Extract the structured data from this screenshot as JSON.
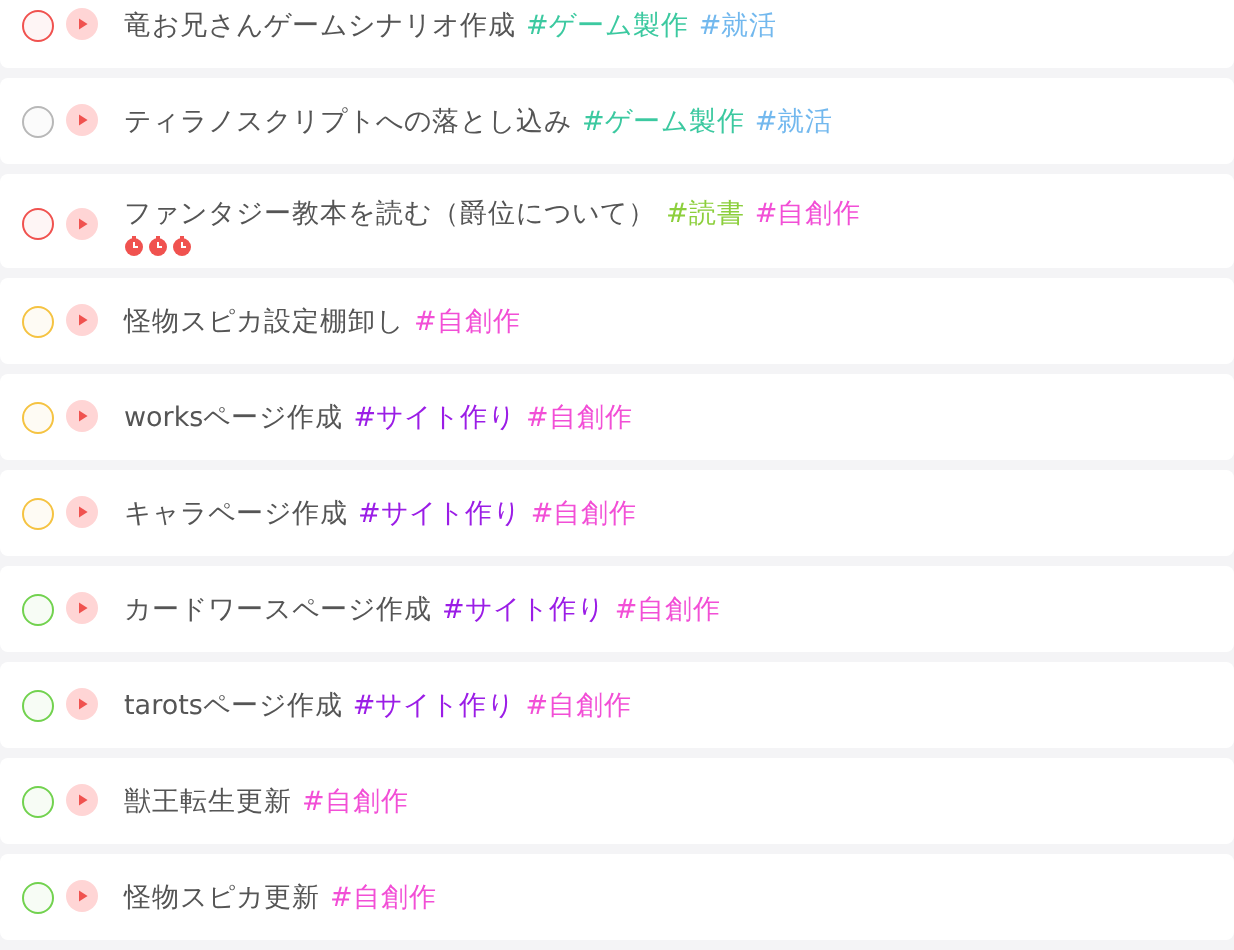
{
  "tasks": [
    {
      "title": "竜お兄さんゲームシナリオ作成",
      "color": "#f0524f",
      "tags": [
        {
          "label": "#ゲーム製作",
          "color": "#3cc9a0"
        },
        {
          "label": "#就活",
          "color": "#72b8ee"
        }
      ]
    },
    {
      "title": "ティラノスクリプトへの落とし込み",
      "color": "#b8b8b8",
      "tags": [
        {
          "label": "#ゲーム製作",
          "color": "#3cc9a0"
        },
        {
          "label": "#就活",
          "color": "#72b8ee"
        }
      ]
    },
    {
      "title": "ファンタジー教本を読む（爵位について）",
      "color": "#f0524f",
      "tags": [
        {
          "label": "#読書",
          "color": "#8ccf3c"
        },
        {
          "label": "#自創作",
          "color": "#f24fd6"
        }
      ],
      "pomodoros": [
        {
          "kind": "tomato"
        },
        {
          "kind": "tomato"
        },
        {
          "kind": "tomato"
        }
      ]
    },
    {
      "title": "怪物スピカ設定棚卸し",
      "color": "#f5c342",
      "tags": [
        {
          "label": "#自創作",
          "color": "#f24fd6"
        }
      ]
    },
    {
      "title": "worksページ作成",
      "color": "#f5c342",
      "tags": [
        {
          "label": "#サイト作り",
          "color": "#9b1de6"
        },
        {
          "label": "#自創作",
          "color": "#f24fd6"
        }
      ]
    },
    {
      "title": "キャラページ作成",
      "color": "#f5c342",
      "tags": [
        {
          "label": "#サイト作り",
          "color": "#9b1de6"
        },
        {
          "label": "#自創作",
          "color": "#f24fd6"
        }
      ]
    },
    {
      "title": "カードワースページ作成",
      "color": "#72d24f",
      "tags": [
        {
          "label": "#サイト作り",
          "color": "#9b1de6"
        },
        {
          "label": "#自創作",
          "color": "#f24fd6"
        }
      ]
    },
    {
      "title": "tarotsページ作成",
      "color": "#72d24f",
      "tags": [
        {
          "label": "#サイト作り",
          "color": "#9b1de6"
        },
        {
          "label": "#自創作",
          "color": "#f24fd6"
        }
      ]
    },
    {
      "title": "獣王転生更新",
      "color": "#72d24f",
      "tags": [
        {
          "label": "#自創作",
          "color": "#f24fd6"
        }
      ]
    },
    {
      "title": "怪物スピカ更新",
      "color": "#72d24f",
      "tags": [
        {
          "label": "#自創作",
          "color": "#f24fd6"
        }
      ]
    }
  ]
}
